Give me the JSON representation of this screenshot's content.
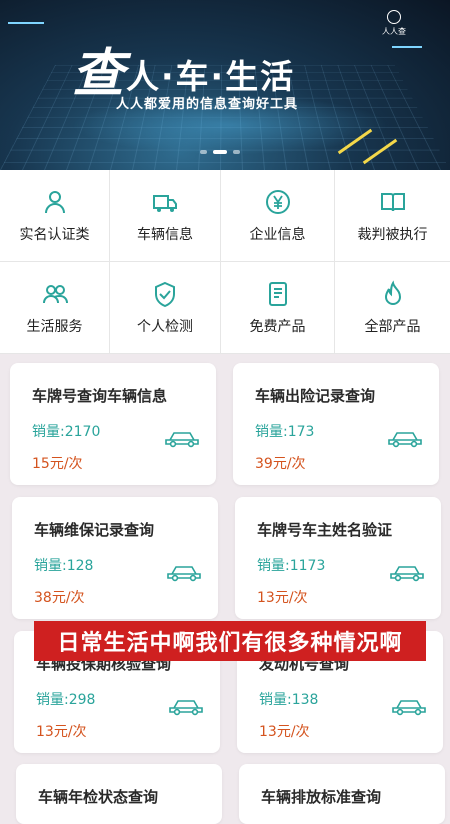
{
  "banner": {
    "title_big": "查",
    "title_rest": "人·车·生活",
    "subtitle": "人人都爱用的信息查询好工具",
    "logo_text": "人人查"
  },
  "categories": [
    {
      "label": "实名认证类",
      "icon": "person-icon"
    },
    {
      "label": "车辆信息",
      "icon": "truck-icon"
    },
    {
      "label": "企业信息",
      "icon": "yen-coin-icon"
    },
    {
      "label": "裁判被执行",
      "icon": "book-icon"
    },
    {
      "label": "生活服务",
      "icon": "group-icon"
    },
    {
      "label": "个人检测",
      "icon": "shield-check-icon"
    },
    {
      "label": "免费产品",
      "icon": "document-icon"
    },
    {
      "label": "全部产品",
      "icon": "flame-icon"
    }
  ],
  "products": [
    {
      "title": "车牌号查询车辆信息",
      "sales": "销量:2170",
      "price": "15元/次"
    },
    {
      "title": "车辆出险记录查询",
      "sales": "销量:173",
      "price": "39元/次"
    },
    {
      "title": "车辆维保记录查询",
      "sales": "销量:128",
      "price": "38元/次"
    },
    {
      "title": "车牌号车主姓名验证",
      "sales": "销量:1173",
      "price": "13元/次"
    },
    {
      "title": "车辆投保期核验查询",
      "sales": "销量:298",
      "price": "13元/次"
    },
    {
      "title": "发动机号查询",
      "sales": "销量:138",
      "price": "13元/次"
    },
    {
      "title": "车辆年检状态查询",
      "sales": "",
      "price": ""
    },
    {
      "title": "车辆排放标准查询",
      "sales": "",
      "price": ""
    }
  ],
  "caption": "日常生活中啊我们有很多种情况啊",
  "colors": {
    "accent": "#2aa49b",
    "price": "#d4531e",
    "caption_bg": "#cf2020"
  }
}
